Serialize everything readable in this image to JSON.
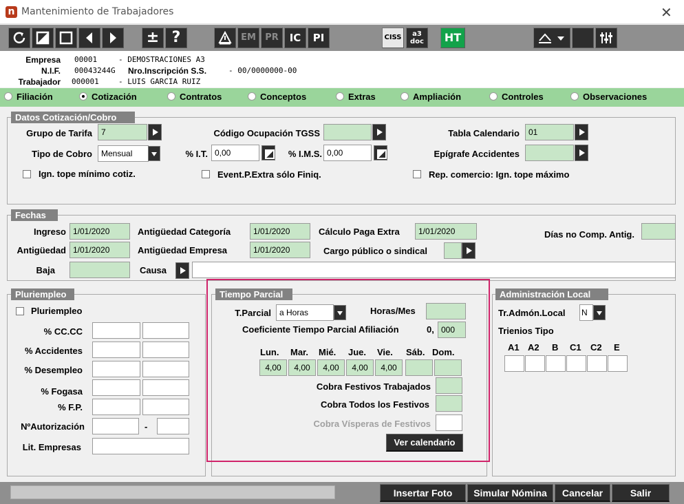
{
  "window": {
    "title": "Mantenimiento de Trabajadores",
    "app_icon": "n",
    "close": "✕"
  },
  "toolbar": {
    "em": "EM",
    "pr": "PR",
    "ic": "IC",
    "pi": "PI",
    "ciss": "CISS",
    "a3doc_1": "a3",
    "a3doc_2": "doc",
    "ht": "HT",
    "plusminus": "±",
    "help": "?"
  },
  "info": {
    "empresa_label": "Empresa",
    "empresa_code": "00001",
    "empresa_name": "- DEMOSTRACIONES A3",
    "nif_label": "N.I.F.",
    "nif_value": "00043244G",
    "inscripcion_label": "Nro.Inscripción S.S.",
    "inscripcion_value": "- 00/0000000-00",
    "trabajador_label": "Trabajador",
    "trabajador_code": "000001",
    "trabajador_name": "- LUIS GARCIA RUIZ"
  },
  "tabs": [
    {
      "label": "Filiación",
      "selected": false
    },
    {
      "label": "Cotización",
      "selected": true
    },
    {
      "label": "Contratos",
      "selected": false
    },
    {
      "label": "Conceptos",
      "selected": false
    },
    {
      "label": "Extras",
      "selected": false
    },
    {
      "label": "Ampliación",
      "selected": false
    },
    {
      "label": "Controles",
      "selected": false
    },
    {
      "label": "Observaciones",
      "selected": false
    }
  ],
  "cotizacion": {
    "section": "Datos Cotización/Cobro",
    "grupo_tarifa_label": "Grupo de Tarifa",
    "grupo_tarifa_value": "7",
    "codigo_ocupacion_label": "Código Ocupación TGSS",
    "codigo_ocupacion_value": "",
    "tabla_calendario_label": "Tabla Calendario",
    "tabla_calendario_value": "01",
    "tipo_cobro_label": "Tipo de Cobro",
    "tipo_cobro_value": "Mensual",
    "it_label": "% I.T.",
    "it_value": "0,00",
    "ims_label": "% I.M.S.",
    "ims_value": "0,00",
    "epigrafe_label": "Epígrafe Accidentes",
    "epigrafe_value": "",
    "ign_tope_min_label": "Ign. tope mínimo cotiz.",
    "event_extra_label": "Event.P.Extra sólo Finiq.",
    "rep_comercio_label": "Rep. comercio: Ign. tope máximo"
  },
  "fechas": {
    "section": "Fechas",
    "ingreso_label": "Ingreso",
    "ingreso_value": "1/01/2020",
    "antig_categoria_label": "Antigüedad Categoría",
    "antig_categoria_value": "1/01/2020",
    "calculo_paga_label": "Cálculo Paga Extra",
    "calculo_paga_value": "1/01/2020",
    "dias_no_comp_label": "Días no Comp. Antig.",
    "dias_no_comp_value": "",
    "antiguedad_label": "Antigüedad",
    "antiguedad_value": "1/01/2020",
    "antig_empresa_label": "Antigüedad Empresa",
    "antig_empresa_value": "1/01/2020",
    "cargo_publico_label": "Cargo público o sindical",
    "baja_label": "Baja",
    "baja_value": "",
    "causa_label": "Causa",
    "causa_value": ""
  },
  "pluriempleo": {
    "section": "Pluriempleo",
    "checkbox_label": "Pluriempleo",
    "rows": [
      "% CC.CC",
      "% Accidentes",
      "% Desempleo",
      "% Fogasa",
      "% F.P."
    ],
    "autorizacion_label": "NºAutorización",
    "autorizacion_sep": "-",
    "lit_empresas_label": "Lit. Empresas"
  },
  "tiempo_parcial": {
    "section": "Tiempo Parcial",
    "tparcial_label": "T.Parcial",
    "tparcial_value": "a Horas",
    "horas_mes_label": "Horas/Mes",
    "horas_mes_value": "",
    "coeficiente_label": "Coeficiente Tiempo Parcial Afiliación",
    "coeficiente_prefix": "0,",
    "coeficiente_value": "000",
    "days": [
      "Lun.",
      "Mar.",
      "Mié.",
      "Jue.",
      "Vie.",
      "Sáb.",
      "Dom."
    ],
    "hours": [
      "4,00",
      "4,00",
      "4,00",
      "4,00",
      "4,00",
      "",
      ""
    ],
    "cobra_festivos_trab_label": "Cobra Festivos Trabajados",
    "cobra_todos_label": "Cobra Todos los Festivos",
    "cobra_visperas_label": "Cobra Vísperas de Festivos",
    "ver_calendario": "Ver calendario"
  },
  "admin_local": {
    "section": "Administración Local",
    "tr_admon_label": "Tr.Admón.Local",
    "tr_admon_value": "N",
    "trienios_label": "Trienios Tipo",
    "trienios": [
      "A1",
      "A2",
      "B",
      "C1",
      "C2",
      "E"
    ]
  },
  "footer": {
    "insertar_foto": "Insertar Foto",
    "simular_nomina": "Simular Nómina",
    "cancelar": "Cancelar",
    "salir": "Salir"
  },
  "colors": {
    "field_green": "#c8e6c8",
    "tab_bar": "#9ad59b",
    "highlight": "#d0236a",
    "toolbar": "#8f8f8f",
    "ht_green": "#12a24a"
  }
}
